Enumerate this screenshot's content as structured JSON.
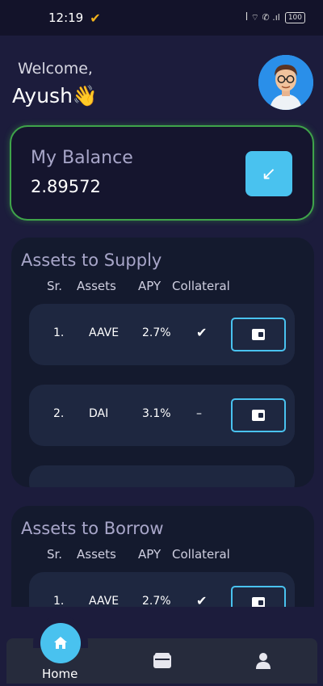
{
  "status_bar": {
    "time": "12:19",
    "check_glyph": "✔",
    "right_icons": "ꟾ ⌔ ✆ .ıl",
    "battery": "100"
  },
  "header": {
    "welcome": "Welcome,",
    "username": "Ayush👋"
  },
  "balance": {
    "label": "My Balance",
    "value": "2.89572",
    "receive_glyph": "↙"
  },
  "supply": {
    "title": "Assets to Supply",
    "columns": [
      "Sr.",
      "Assets",
      "APY",
      "Collateral"
    ],
    "rows": [
      {
        "sr": "1.",
        "asset": "AAVE",
        "apy": "2.7%",
        "collateral": "✔"
      },
      {
        "sr": "2.",
        "asset": "DAI",
        "apy": "3.1%",
        "collateral": "–"
      }
    ]
  },
  "borrow": {
    "title": "Assets to Borrow",
    "columns": [
      "Sr.",
      "Assets",
      "APY",
      "Collateral"
    ],
    "rows": [
      {
        "sr": "1.",
        "asset": "AAVE",
        "apy": "2.7%",
        "collateral": "✔"
      }
    ]
  },
  "nav": {
    "home_label": "Home",
    "icons": [
      "home-icon",
      "wallet-icon",
      "profile-icon"
    ]
  },
  "colors": {
    "accent": "#49c2ef",
    "balance_border": "#3fa44a",
    "background": "#1c1c3c",
    "card": "#1e2740"
  }
}
